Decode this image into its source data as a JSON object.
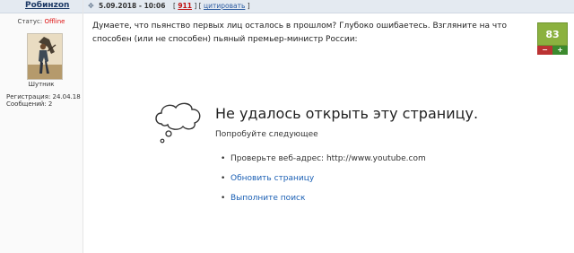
{
  "user": {
    "name": "Робинzon",
    "status_label": "Статус:",
    "status_value": "Offline",
    "rank": "Шутник",
    "registration": "Регистрация: 24.04.18",
    "messages": "Сообщений: 2"
  },
  "post": {
    "date": "5.09.2018 - 10:06",
    "sep1": "[",
    "number": "911",
    "sep2": "] [",
    "cite": "цитировать",
    "sep3": "]",
    "text": "Думаете, что пьянство первых лиц осталось в прошлом? Глубоко ошибаетесь. Взгляните на что способен (или не способен) пьяный премьер-министр России:"
  },
  "rating": {
    "value": "83",
    "minus": "−",
    "plus": "+"
  },
  "error": {
    "title": "Не удалось открыть эту страницу.",
    "subtitle": "Попробуйте следующее",
    "items": [
      {
        "text": "Проверьте веб-адрес: http://www.youtube.com"
      },
      {
        "text": "Обновить страницу"
      },
      {
        "text": "Выполните поиск"
      }
    ]
  }
}
